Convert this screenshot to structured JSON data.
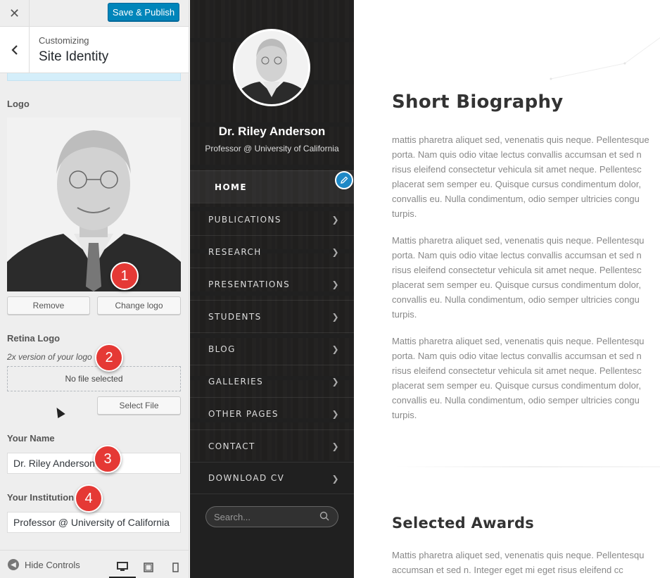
{
  "customizer": {
    "close_glyph": "✕",
    "publish_label": "Save & Publish",
    "back_glyph": "‹",
    "subtitle": "Customizing",
    "title": "Site Identity",
    "logo_label": "Logo",
    "remove_label": "Remove",
    "change_logo_label": "Change logo",
    "retina_label": "Retina Logo",
    "retina_desc": "2x version of your logo",
    "no_file_text": "No file selected",
    "select_file_label": "Select File",
    "name_label": "Your Name",
    "name_value": "Dr. Riley Anderson",
    "institution_label": "Your Institution",
    "institution_value": "Professor @ University of California",
    "hide_controls_label": "Hide Controls",
    "badges": [
      "1",
      "2",
      "3",
      "4"
    ]
  },
  "sidebar": {
    "name": "Dr. Riley Anderson",
    "subtitle": "Professor @ University of California",
    "menu": [
      "HOME",
      "PUBLICATIONS",
      "RESEARCH",
      "PRESENTATIONS",
      "STUDENTS",
      "BLOG",
      "GALLERIES",
      "OTHER PAGES",
      "CONTACT",
      "DOWNLOAD CV"
    ],
    "search_placeholder": "Search..."
  },
  "main": {
    "bio_heading": "Short Biography",
    "para1": "mattis pharetra aliquet sed, venenatis quis neque. Pellentesque\nporta. Nam quis odio vitae lectus convallis accumsan et sed n\nrisus eleifend consectetur vehicula sit amet neque. Pellentesc\nplacerat sem semper eu. Quisque cursus condimentum dolor,\nconvallis eu. Nulla condimentum, odio semper ultricies congu\nturpis.",
    "para2": "Mattis pharetra aliquet sed, venenatis quis neque. Pellentesqu\nporta. Nam quis odio vitae lectus convallis accumsan et sed n\nrisus eleifend consectetur vehicula sit amet neque. Pellentesc\nplacerat sem semper eu. Quisque cursus condimentum dolor,\nconvallis eu. Nulla condimentum, odio semper ultricies congu\nturpis.",
    "para3": "Mattis pharetra aliquet sed, venenatis quis neque. Pellentesqu\nporta. Nam quis odio vitae lectus convallis accumsan et sed n\nrisus eleifend consectetur vehicula sit amet neque. Pellentesc\nplacerat sem semper eu. Quisque cursus condimentum dolor,\nconvallis eu. Nulla condimentum, odio semper ultricies congu\nturpis.",
    "awards_heading": "Selected Awards",
    "para4": "Mattis pharetra aliquet sed, venenatis quis neque. Pellentesqu\naccumsan et sed n. Integer eget mi eget risus eleifend cc"
  },
  "colors": {
    "primary_button": "#0085ba",
    "badge": "#e53935",
    "edit_pencil": "#1e88c6"
  }
}
